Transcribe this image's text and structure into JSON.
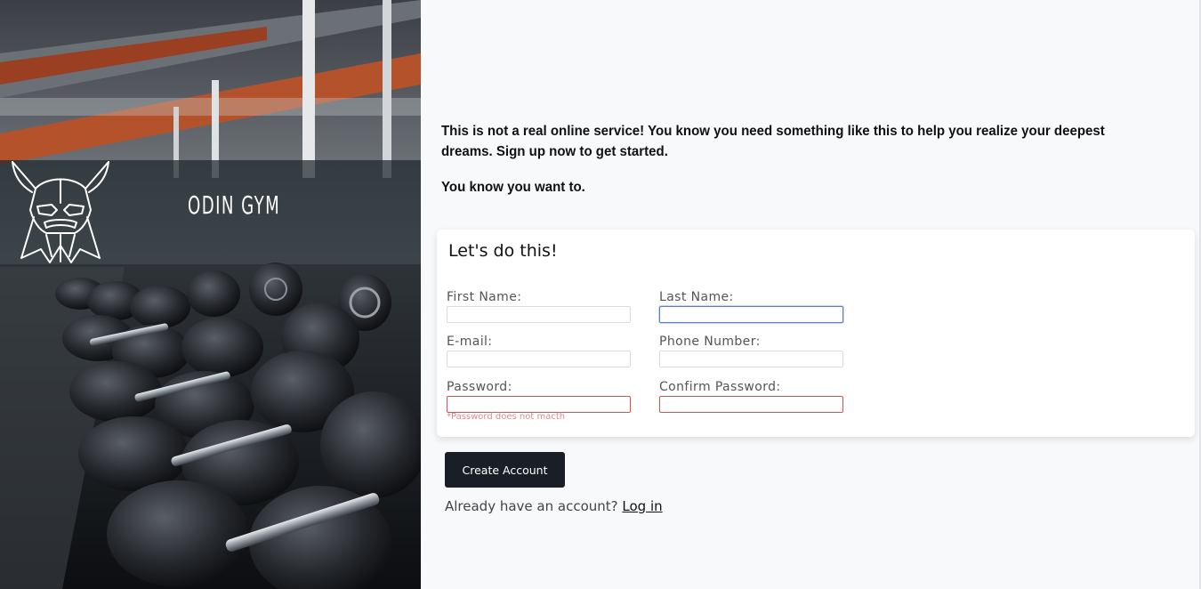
{
  "brand": {
    "name": "ODIN GYM"
  },
  "intro": {
    "line1": "This is not a real online service! You know you need something like this to help you realize your deepest dreams. Sign up now to get started.",
    "line2": "You know you want to."
  },
  "form": {
    "title": "Let's do this!",
    "first_name_label": "First Name:",
    "last_name_label": "Last Name:",
    "email_label": "E-mail:",
    "phone_label": "Phone Number:",
    "password_label": "Password:",
    "confirm_password_label": "Confirm Password:",
    "password_error": "*Password does not macth",
    "values": {
      "first_name": "",
      "last_name": "",
      "email": "",
      "phone": "",
      "password": "",
      "confirm_password": ""
    }
  },
  "actions": {
    "create_account_label": "Create Account",
    "login_prompt": "Already have an account?",
    "login_link": "Log in"
  },
  "colors": {
    "page_bg": "#f8f9fb",
    "button_bg": "#1a1f27",
    "error_red": "#d9534f",
    "focus_blue": "#5b7ec4"
  }
}
